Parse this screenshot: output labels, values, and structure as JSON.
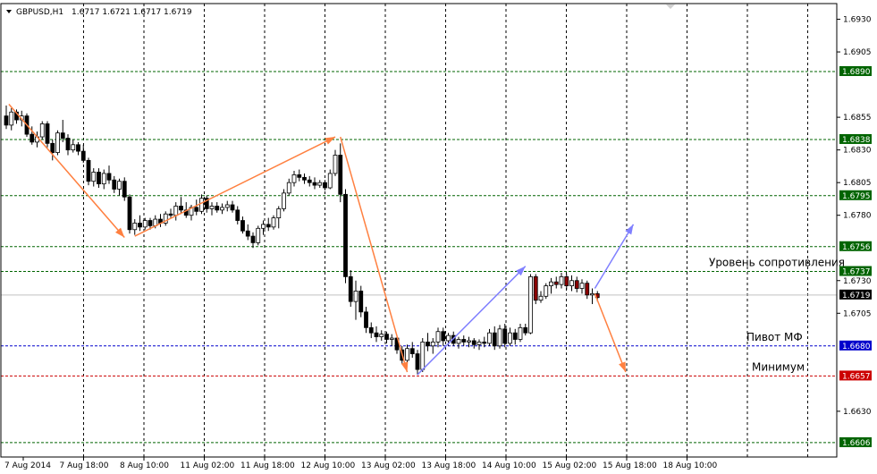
{
  "header": {
    "symbol": "GBPUSD,H1",
    "ohlc": "1.6717 1.6721 1.6717 1.6719"
  },
  "chart_data": {
    "type": "candlestick",
    "ylim": [
      1.6595,
      1.6942
    ],
    "y_ticks": [
      "1.6930",
      "1.6905",
      "1.6855",
      "1.6830",
      "1.6805",
      "1.6780",
      "1.6730",
      "1.6705",
      "1.6630"
    ],
    "x_ticks": [
      "7 Aug 2014",
      "7 Aug 18:00",
      "8 Aug 10:00",
      "11 Aug 02:00",
      "11 Aug 18:00",
      "12 Aug 10:00",
      "13 Aug 02:00",
      "13 Aug 18:00",
      "14 Aug 10:00",
      "15 Aug 02:00",
      "15 Aug 18:00",
      "18 Aug 10:00"
    ],
    "levels": [
      {
        "price": 1.689,
        "label": "1.6890",
        "color": "#006400",
        "style": "dashed"
      },
      {
        "price": 1.6838,
        "label": "1.6838",
        "color": "#006400",
        "style": "dashed"
      },
      {
        "price": 1.6795,
        "label": "1.6795",
        "color": "#006400",
        "style": "dashed"
      },
      {
        "price": 1.6756,
        "label": "1.6756",
        "color": "#006400",
        "style": "dashed"
      },
      {
        "price": 1.6737,
        "label": "1.6737",
        "color": "#006400",
        "style": "dashed"
      },
      {
        "price": 1.6719,
        "label": "1.6719",
        "color": "#000000",
        "style": "solid"
      },
      {
        "price": 1.668,
        "label": "1.6680",
        "color": "#0000cc",
        "style": "dashed"
      },
      {
        "price": 1.6657,
        "label": "1.6657",
        "color": "#cc0000",
        "style": "dashed"
      },
      {
        "price": 1.6606,
        "label": "1.6606",
        "color": "#006400",
        "style": "dashed"
      }
    ],
    "annotations": [
      {
        "text": "Уровень сопротивления",
        "price": 1.6737
      },
      {
        "text": "Пивот МФ",
        "price": 1.668
      },
      {
        "text": "Минимум",
        "price": 1.6657
      }
    ],
    "arrows": [
      {
        "color": "#ff8040",
        "from": [
          0.5,
          1.6865
        ],
        "to": [
          23.0,
          1.6763
        ]
      },
      {
        "color": "#ff8040",
        "from": [
          25.0,
          1.6764
        ],
        "to": [
          64.0,
          1.684
        ]
      },
      {
        "color": "#ff8040",
        "from": [
          65.0,
          1.684
        ],
        "to": [
          78.0,
          1.666
        ]
      },
      {
        "color": "#8080ff",
        "from": [
          80.0,
          1.6658
        ],
        "to": [
          101.0,
          1.6741
        ]
      },
      {
        "color": "#8080ff",
        "from": [
          114.5,
          1.6724
        ],
        "to": [
          122.0,
          1.6773
        ]
      },
      {
        "color": "#ff8040",
        "from": [
          114.5,
          1.672
        ],
        "to": [
          120.5,
          1.666
        ]
      }
    ],
    "candles": [
      [
        1.6856,
        1.6864,
        1.6846,
        1.6849
      ],
      [
        1.6849,
        1.6862,
        1.6845,
        1.6859
      ],
      [
        1.6859,
        1.6861,
        1.685,
        1.6853
      ],
      [
        1.6853,
        1.686,
        1.6848,
        1.6856
      ],
      [
        1.6856,
        1.6858,
        1.684,
        1.6842
      ],
      [
        1.6842,
        1.6848,
        1.6834,
        1.6836
      ],
      [
        1.6836,
        1.6844,
        1.6832,
        1.684
      ],
      [
        1.684,
        1.6852,
        1.6838,
        1.685
      ],
      [
        1.685,
        1.6852,
        1.6832,
        1.6835
      ],
      [
        1.6835,
        1.6838,
        1.6822,
        1.6828
      ],
      [
        1.6828,
        1.6845,
        1.6826,
        1.6843
      ],
      [
        1.6843,
        1.6853,
        1.6836,
        1.6839
      ],
      [
        1.6839,
        1.6842,
        1.6826,
        1.683
      ],
      [
        1.683,
        1.6838,
        1.6828,
        1.6834
      ],
      [
        1.6834,
        1.6836,
        1.6826,
        1.6829
      ],
      [
        1.6829,
        1.6834,
        1.682,
        1.6822
      ],
      [
        1.6822,
        1.6824,
        1.6803,
        1.6806
      ],
      [
        1.6806,
        1.6816,
        1.6802,
        1.6813
      ],
      [
        1.6813,
        1.6816,
        1.6801,
        1.6804
      ],
      [
        1.6804,
        1.6815,
        1.68,
        1.6812
      ],
      [
        1.6812,
        1.6818,
        1.6804,
        1.6807
      ],
      [
        1.6807,
        1.681,
        1.6797,
        1.68
      ],
      [
        1.68,
        1.6808,
        1.6795,
        1.6806
      ],
      [
        1.6806,
        1.6809,
        1.6791,
        1.6794
      ],
      [
        1.6794,
        1.6796,
        1.6766,
        1.6769
      ],
      [
        1.6769,
        1.6777,
        1.6765,
        1.6774
      ],
      [
        1.6774,
        1.678,
        1.6768,
        1.6771
      ],
      [
        1.6771,
        1.6778,
        1.6769,
        1.6776
      ],
      [
        1.6776,
        1.6778,
        1.6769,
        1.6772
      ],
      [
        1.6772,
        1.678,
        1.677,
        1.6777
      ],
      [
        1.6777,
        1.6781,
        1.6771,
        1.6774
      ],
      [
        1.6774,
        1.6783,
        1.6772,
        1.6781
      ],
      [
        1.6781,
        1.6785,
        1.6778,
        1.678
      ],
      [
        1.678,
        1.679,
        1.6776,
        1.6787
      ],
      [
        1.6787,
        1.6794,
        1.6781,
        1.6784
      ],
      [
        1.6784,
        1.679,
        1.6778,
        1.678
      ],
      [
        1.678,
        1.6788,
        1.6776,
        1.6786
      ],
      [
        1.6786,
        1.6792,
        1.678,
        1.6783
      ],
      [
        1.6783,
        1.6796,
        1.6781,
        1.6793
      ],
      [
        1.6793,
        1.6795,
        1.6782,
        1.6785
      ],
      [
        1.6785,
        1.679,
        1.678,
        1.6787
      ],
      [
        1.6787,
        1.679,
        1.6782,
        1.6784
      ],
      [
        1.6784,
        1.6789,
        1.6781,
        1.6786
      ],
      [
        1.6786,
        1.6791,
        1.6783,
        1.6788
      ],
      [
        1.6788,
        1.6791,
        1.6782,
        1.6784
      ],
      [
        1.6784,
        1.6787,
        1.6773,
        1.6776
      ],
      [
        1.6776,
        1.6779,
        1.6766,
        1.6768
      ],
      [
        1.6768,
        1.6773,
        1.6761,
        1.6764
      ],
      [
        1.6764,
        1.6767,
        1.6755,
        1.6759
      ],
      [
        1.6759,
        1.6772,
        1.6757,
        1.677
      ],
      [
        1.677,
        1.6776,
        1.6765,
        1.6773
      ],
      [
        1.6773,
        1.6778,
        1.6768,
        1.6771
      ],
      [
        1.6771,
        1.678,
        1.6769,
        1.6778
      ],
      [
        1.6778,
        1.6787,
        1.677,
        1.6785
      ],
      [
        1.6785,
        1.68,
        1.6783,
        1.6797
      ],
      [
        1.6797,
        1.6808,
        1.6795,
        1.6805
      ],
      [
        1.6805,
        1.6814,
        1.6802,
        1.6811
      ],
      [
        1.6811,
        1.6815,
        1.6806,
        1.6809
      ],
      [
        1.6809,
        1.6812,
        1.6804,
        1.6807
      ],
      [
        1.6807,
        1.681,
        1.6802,
        1.6805
      ],
      [
        1.6805,
        1.6809,
        1.68,
        1.6803
      ],
      [
        1.6803,
        1.6807,
        1.6801,
        1.6805
      ],
      [
        1.6805,
        1.6807,
        1.6799,
        1.6801
      ],
      [
        1.6801,
        1.6815,
        1.68,
        1.6812
      ],
      [
        1.6812,
        1.683,
        1.681,
        1.6826
      ],
      [
        1.6826,
        1.6835,
        1.679,
        1.6796
      ],
      [
        1.6796,
        1.68,
        1.6728,
        1.6733
      ],
      [
        1.6733,
        1.6738,
        1.671,
        1.6714
      ],
      [
        1.6714,
        1.673,
        1.67,
        1.6722
      ],
      [
        1.6722,
        1.6726,
        1.6702,
        1.6706
      ],
      [
        1.6706,
        1.671,
        1.669,
        1.6694
      ],
      [
        1.6694,
        1.6698,
        1.6686,
        1.669
      ],
      [
        1.669,
        1.6695,
        1.6683,
        1.6687
      ],
      [
        1.6687,
        1.6692,
        1.6684,
        1.6689
      ],
      [
        1.6689,
        1.6691,
        1.6682,
        1.6685
      ],
      [
        1.6685,
        1.6689,
        1.668,
        1.6686
      ],
      [
        1.6686,
        1.6688,
        1.6674,
        1.6677
      ],
      [
        1.6677,
        1.668,
        1.6666,
        1.6669
      ],
      [
        1.6669,
        1.6681,
        1.6665,
        1.6678
      ],
      [
        1.6678,
        1.6683,
        1.6671,
        1.6674
      ],
      [
        1.6674,
        1.6677,
        1.6658,
        1.6662
      ],
      [
        1.6662,
        1.6686,
        1.666,
        1.6683
      ],
      [
        1.6683,
        1.669,
        1.6676,
        1.668
      ],
      [
        1.668,
        1.6686,
        1.6674,
        1.6683
      ],
      [
        1.6683,
        1.6694,
        1.6679,
        1.6691
      ],
      [
        1.6691,
        1.6694,
        1.668,
        1.6684
      ],
      [
        1.6684,
        1.669,
        1.668,
        1.6688
      ],
      [
        1.6688,
        1.6691,
        1.668,
        1.6682
      ],
      [
        1.6682,
        1.6687,
        1.6678,
        1.6685
      ],
      [
        1.6685,
        1.6688,
        1.668,
        1.6683
      ],
      [
        1.6683,
        1.6687,
        1.6679,
        1.6684
      ],
      [
        1.6684,
        1.6686,
        1.6678,
        1.6681
      ],
      [
        1.6681,
        1.6685,
        1.6677,
        1.6683
      ],
      [
        1.6683,
        1.6687,
        1.6679,
        1.6682
      ],
      [
        1.6682,
        1.6693,
        1.668,
        1.669
      ],
      [
        1.669,
        1.6695,
        1.6677,
        1.668
      ],
      [
        1.668,
        1.6696,
        1.6678,
        1.6693
      ],
      [
        1.6693,
        1.6697,
        1.6679,
        1.6682
      ],
      [
        1.6682,
        1.6694,
        1.668,
        1.669
      ],
      [
        1.669,
        1.6693,
        1.6681,
        1.6685
      ],
      [
        1.6685,
        1.6697,
        1.6683,
        1.6694
      ],
      [
        1.6694,
        1.6697,
        1.6688,
        1.669
      ],
      [
        1.669,
        1.6735,
        1.6689,
        1.6733
      ],
      [
        1.6733,
        1.6735,
        1.6712,
        1.6715
      ],
      [
        1.6715,
        1.6722,
        1.6713,
        1.6718
      ],
      [
        1.6718,
        1.6728,
        1.6716,
        1.6726
      ],
      [
        1.6726,
        1.6732,
        1.672,
        1.6729
      ],
      [
        1.6729,
        1.6733,
        1.6724,
        1.6727
      ],
      [
        1.6727,
        1.6736,
        1.6724,
        1.6733
      ],
      [
        1.6733,
        1.6735,
        1.6723,
        1.6726
      ],
      [
        1.6726,
        1.6734,
        1.6722,
        1.673
      ],
      [
        1.673,
        1.6733,
        1.6721,
        1.6724
      ],
      [
        1.6724,
        1.6731,
        1.672,
        1.6728
      ],
      [
        1.6728,
        1.673,
        1.6716,
        1.6719
      ],
      [
        1.6719,
        1.6724,
        1.6712,
        1.672
      ],
      [
        1.672,
        1.6722,
        1.6714,
        1.6717
      ]
    ]
  }
}
